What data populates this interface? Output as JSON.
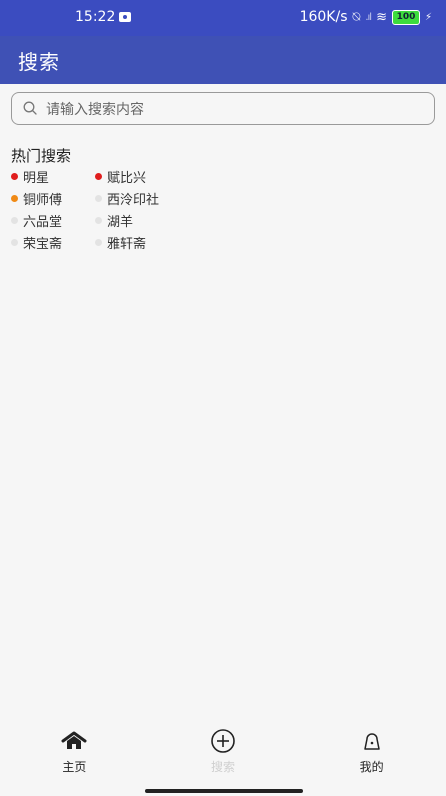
{
  "status_bar": {
    "time": "15:22",
    "net_speed": "160K/s",
    "battery": "100"
  },
  "app_bar": {
    "title": "搜索"
  },
  "search": {
    "placeholder": "请输入搜索内容",
    "value": ""
  },
  "hot": {
    "title": "热门搜索",
    "items": [
      {
        "label": "明星",
        "dot": "#e01d1d"
      },
      {
        "label": "赋比兴",
        "dot": "#e01d1d"
      },
      {
        "label": "铜师傅",
        "dot": "#f08a16"
      },
      {
        "label": "西泠印社",
        "dot": "#e3e3e3"
      },
      {
        "label": "六品堂",
        "dot": "#e3e3e3"
      },
      {
        "label": "湖羊",
        "dot": "#e3e3e3"
      },
      {
        "label": "荣宝斋",
        "dot": "#e3e3e3"
      },
      {
        "label": "雅轩斋",
        "dot": "#e3e3e3"
      }
    ]
  },
  "bottom_nav": {
    "items": [
      {
        "label": "主页",
        "icon": "home-icon",
        "color": "#222222"
      },
      {
        "label": "搜索",
        "icon": "plus-circle-icon",
        "color": "#cfcfcf"
      },
      {
        "label": "我的",
        "icon": "user-icon",
        "color": "#222222"
      }
    ]
  },
  "colors": {
    "primary": "#3f51b5",
    "status_bar": "#3b4cc0",
    "background": "#f6f6f6"
  }
}
